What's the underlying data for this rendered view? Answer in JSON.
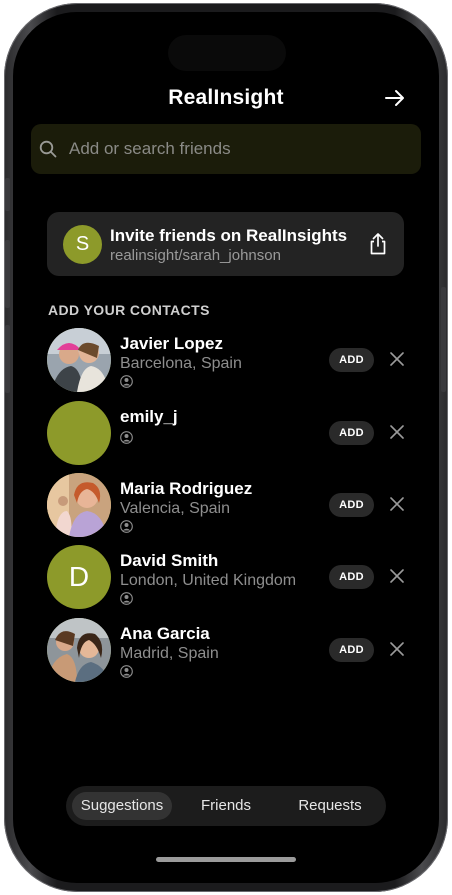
{
  "header": {
    "title": "RealInsight",
    "exit_icon": "arrow-right-icon"
  },
  "search": {
    "placeholder": "Add or search friends",
    "icon": "search-icon"
  },
  "invite": {
    "avatar_letter": "S",
    "title": "Invite friends on RealInsights",
    "link": "realinsight/sarah_johnson",
    "share_icon": "share-icon"
  },
  "contacts_section": {
    "label": "ADD YOUR CONTACTS",
    "add_label": "ADD",
    "items": [
      {
        "name": "Javier Lopez",
        "location": "Barcelona, Spain",
        "avatar": "photo",
        "avatar_letter": ""
      },
      {
        "name": "emily_j",
        "location": "",
        "avatar": "plain",
        "avatar_letter": ""
      },
      {
        "name": "Maria Rodriguez",
        "location": "Valencia, Spain",
        "avatar": "photo",
        "avatar_letter": ""
      },
      {
        "name": "David Smith",
        "location": "London, United Kingdom",
        "avatar": "letter",
        "avatar_letter": "D"
      },
      {
        "name": "Ana Garcia",
        "location": "Madrid, Spain",
        "avatar": "photo",
        "avatar_letter": ""
      }
    ]
  },
  "tabs": {
    "items": [
      {
        "label": "Suggestions",
        "active": true
      },
      {
        "label": "Friends",
        "active": false
      },
      {
        "label": "Requests",
        "active": false
      }
    ]
  },
  "colors": {
    "accent_olive": "#8d9a2a",
    "search_background": "#1b1c0a",
    "card_background": "#232323",
    "background": "#000000"
  }
}
